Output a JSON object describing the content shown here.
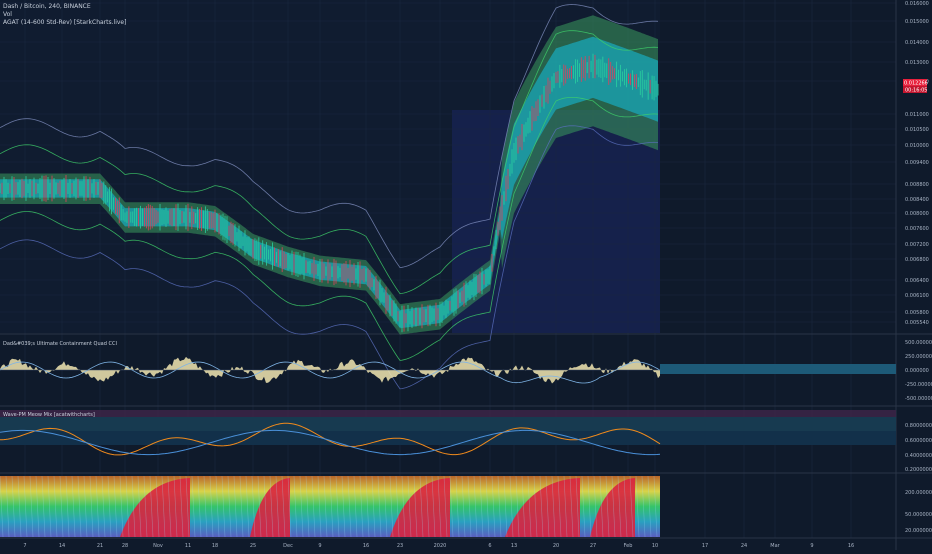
{
  "legend": {
    "symbol_line": "Dash / Bitcoin, 240, BINANCE",
    "vol_label": "Vol",
    "agat_label": "AGAT (14-600 Std-Rev) [StarkCharts.live]"
  },
  "price_badge": {
    "value": "0.012266",
    "countdown": "00:16:05"
  },
  "panels": {
    "cci_title": "Dad&#039;s Ultimate Containment Quad CCI",
    "wave_title": "Wave-PM Meow Mix [acatwithcharts]"
  },
  "price_axis": [
    "0.016000",
    "0.015000",
    "0.014000",
    "0.013000",
    "0.012000",
    "0.011000",
    "0.010500",
    "0.010000",
    "0.009400",
    "0.008800",
    "0.008400",
    "0.008000",
    "0.007600",
    "0.007200",
    "0.006800",
    "0.006400",
    "0.006100",
    "0.005800",
    "0.005540"
  ],
  "cci_axis": [
    "500.000000",
    "250.000000",
    "0.000000",
    "-250.000000",
    "-500.000000"
  ],
  "wave_axis": [
    "0.8000000",
    "0.6000000",
    "0.4000000",
    "0.2000000"
  ],
  "heat_axis": [
    "200.000000",
    "50.000000",
    "20.000000"
  ],
  "time_axis": [
    "7",
    "14",
    "21",
    "28",
    "Nov",
    "11",
    "18",
    "25",
    "Dec",
    "9",
    "16",
    "23",
    "2020",
    "6",
    "13",
    "20",
    "27",
    "Feb",
    "10",
    "17",
    "24",
    "Mar",
    "9",
    "16"
  ],
  "colors": {
    "background": "#0f1a2b",
    "cyan_band": "#19a7b8",
    "green_band": "#3a9a5f",
    "navy_band": "#1c2d6b",
    "badge": "#e8203c",
    "cci_fill": "#f2e7b2",
    "cci_fill_neg": "#7fb4e6",
    "wave_orange": "#f08a1c",
    "wave_blue": "#4a90d9",
    "wave_zone": "#1d5a78"
  },
  "chart_data": {
    "type": "line",
    "title": "Dash / Bitcoin, 240, BINANCE",
    "y_scale": "log",
    "ylim": [
      0.00554,
      0.0165
    ],
    "series": [
      {
        "name": "Dash / Bitcoin",
        "x": [
          "7",
          "14",
          "21",
          "28",
          "Nov",
          "11",
          "18",
          "25",
          "Dec",
          "9",
          "16",
          "23",
          "2020",
          "6",
          "13",
          "20",
          "27",
          "Feb"
        ],
        "values": [
          0.0089,
          0.0089,
          0.0089,
          0.0081,
          0.0081,
          0.0081,
          0.008,
          0.0073,
          0.007,
          0.0068,
          0.0067,
          0.0058,
          0.0059,
          0.0067,
          0.01,
          0.0128,
          0.0133,
          0.0123
        ]
      }
    ],
    "xlabel": "",
    "ylabel": ""
  }
}
